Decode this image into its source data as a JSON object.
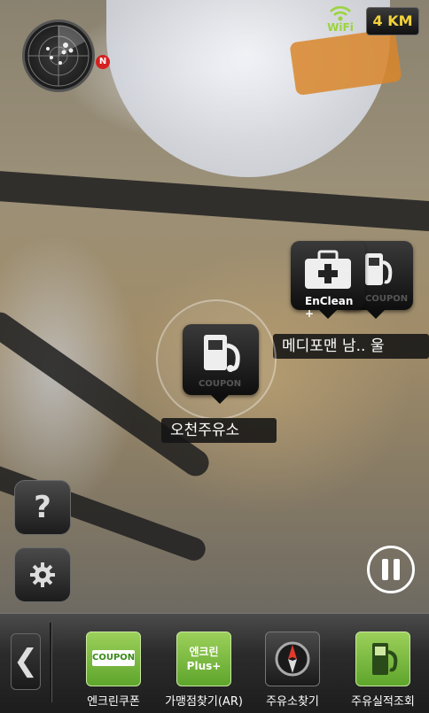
{
  "status": {
    "wifi_label": "WiFi",
    "distance": "4 KM"
  },
  "radar": {
    "north_label": "N"
  },
  "pois": [
    {
      "name": "오천주유소",
      "icon": "gas-station-icon",
      "sub": "COUPON"
    },
    {
      "name": "메디포맨 남.. 울",
      "icon": "first-aid-icon",
      "sub": "EnClean +"
    },
    {
      "name": "",
      "icon": "gas-station-icon",
      "sub": "COUPON"
    }
  ],
  "side_buttons": {
    "help": "?",
    "settings_icon": "gear-icon"
  },
  "bottom_nav": {
    "back_icon": "chevron-left-icon",
    "items": [
      {
        "label": "엔크린쿠폰",
        "icon": "coupon-icon",
        "icon_text": "COUPON"
      },
      {
        "label": "가맹점찾기(AR)",
        "icon": "enclean-plus-icon",
        "icon_text": "엔크린 Plus+"
      },
      {
        "label": "주유소찾기",
        "icon": "compass-icon"
      },
      {
        "label": "주유실적조회",
        "icon": "fuel-pump-icon"
      }
    ]
  },
  "colors": {
    "accent_green": "#9ad43a",
    "distance_text": "#f2d23a",
    "bar_bg": "#2b2b2b"
  }
}
